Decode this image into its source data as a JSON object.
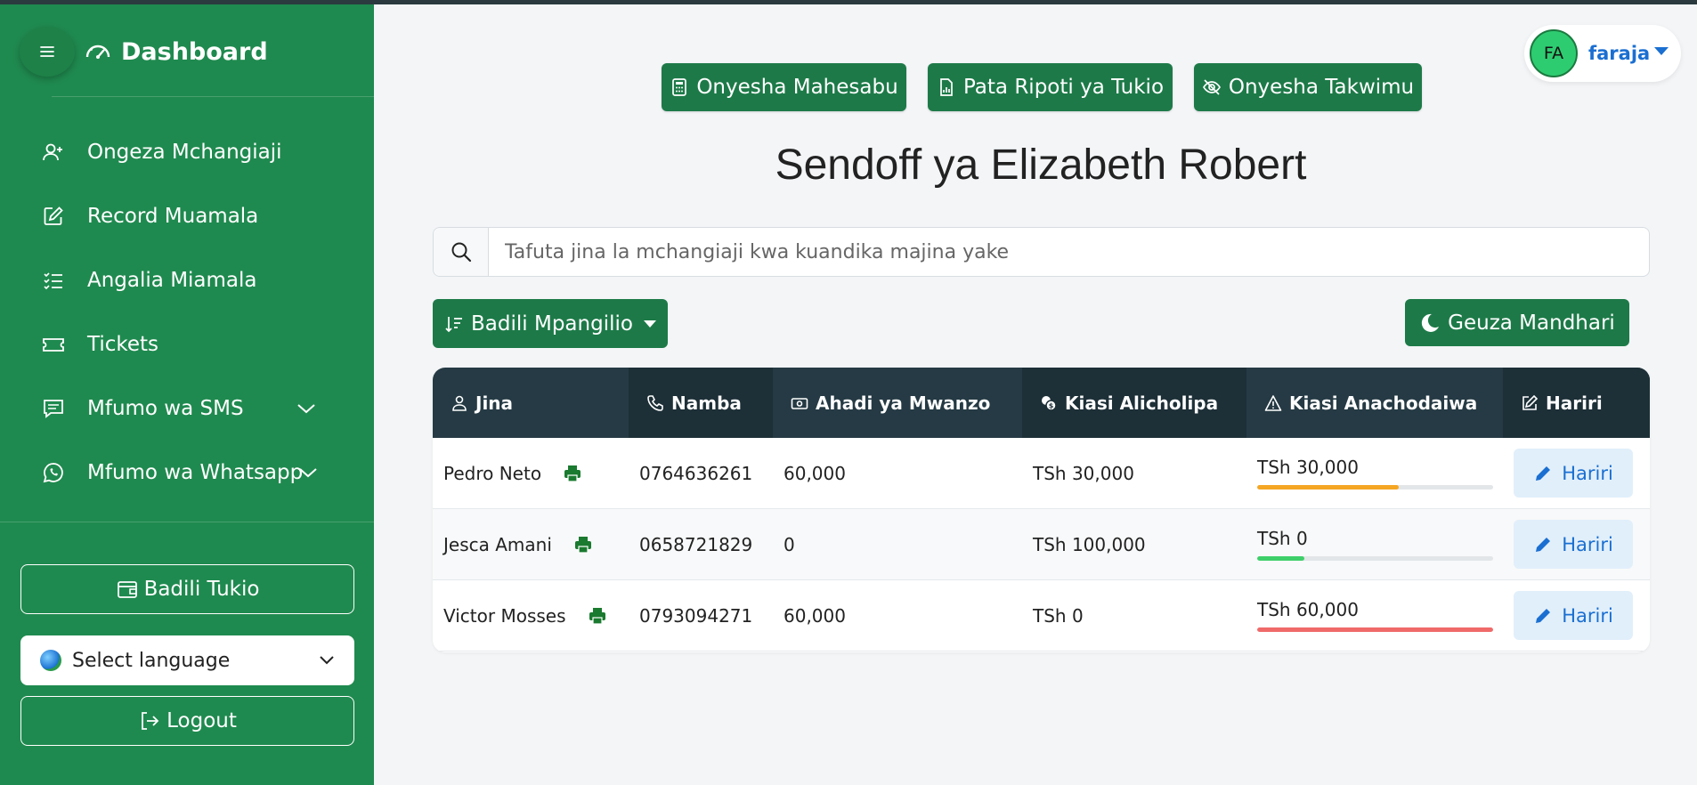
{
  "sidebar": {
    "title": "Dashboard",
    "items": [
      {
        "label": "Ongeza Mchangiaji"
      },
      {
        "label": "Record Muamala"
      },
      {
        "label": "Angalia Miamala"
      },
      {
        "label": "Tickets"
      },
      {
        "label": "Mfumo wa SMS"
      },
      {
        "label": "Mfumo wa Whatsapp"
      }
    ],
    "switch_event": "Badili Tukio",
    "language": "Select language",
    "logout": "Logout"
  },
  "user": {
    "initials": "FA",
    "name": "faraja"
  },
  "toolbar": {
    "calc": "Onyesha Mahesabu",
    "report": "Pata Ripoti ya Tukio",
    "stats": "Onyesha Takwimu"
  },
  "page_title": "Sendoff ya Elizabeth Robert",
  "search": {
    "placeholder": "Tafuta jina la mchangiaji kwa kuandika majina yake"
  },
  "sort_label": "Badili Mpangilio",
  "theme_label": "Geuza Mandhari",
  "table": {
    "headers": {
      "name": "Jina",
      "phone": "Namba",
      "pledge": "Ahadi ya Mwanzo",
      "paid": "Kiasi Alicholipa",
      "owed": "Kiasi Anachodaiwa",
      "edit": "Hariri"
    },
    "rows": [
      {
        "name": "Pedro Neto",
        "phone": "0764636261",
        "pledge": "60,000",
        "paid": "TSh 30,000",
        "owed": "TSh 30,000",
        "progress": 0.6,
        "bar_color": "#f5a623",
        "edit": "Hariri"
      },
      {
        "name": "Jesca Amani",
        "phone": "0658721829",
        "pledge": "0",
        "paid": "TSh 100,000",
        "owed": "TSh 0",
        "progress": 0.2,
        "bar_color": "#3ecf6a",
        "edit": "Hariri"
      },
      {
        "name": "Victor Mosses",
        "phone": "0793094271",
        "pledge": "60,000",
        "paid": "TSh 0",
        "owed": "TSh 60,000",
        "progress": 1.0,
        "bar_color": "#f06a6a",
        "edit": "Hariri"
      }
    ]
  },
  "colors": {
    "sidebar": "#1f8a4f",
    "button": "#1d7a48",
    "table_header": "#253a44",
    "link": "#1a6fd1"
  }
}
